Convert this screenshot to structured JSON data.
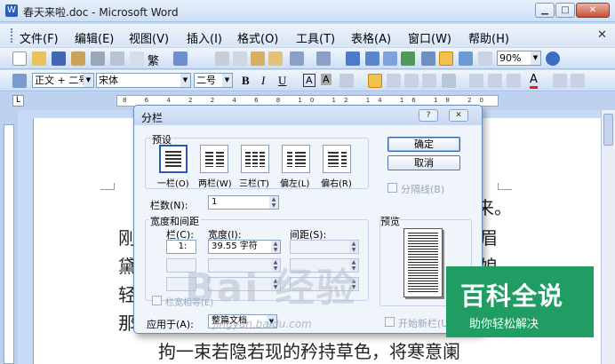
{
  "window": {
    "title": "春天来啦.doc - Microsoft Word",
    "min": "▁",
    "max": "□",
    "close": "✕"
  },
  "menu": [
    "文件(F)",
    "编辑(E)",
    "视图(V)",
    "插入(I)",
    "格式(O)",
    "工具(T)",
    "表格(A)",
    "窗口(W)",
    "帮助(H)"
  ],
  "toolbar": {
    "font_size_trad": "繁",
    "zoom": "90%"
  },
  "format": {
    "style": "正文 + 二号",
    "font": "宋体",
    "size": "二号",
    "bold": "B",
    "italic": "I",
    "underline": "U",
    "char_border": "A",
    "char_shade": "A",
    "font_color": "A"
  },
  "ruler": {
    "ticks": "8 6 4 2 2 4 6 8 10 12 14 16 18 20 22 24 26 28 30 32 34 36 38"
  },
  "document": {
    "l1_left": "刚",
    "l1_right": "眉",
    "l2_left": "黛",
    "l2_right": "娘。",
    "l3_left": "轻",
    "l4_left": "那",
    "l0_right": "来。",
    "l5": "拘一束若隐若现的矜持草色，将寒意阑"
  },
  "dialog": {
    "title": "分栏",
    "help": "?",
    "close": "✕",
    "presets_label": "预设",
    "presets": [
      "一栏(O)",
      "两栏(W)",
      "三栏(T)",
      "偏左(L)",
      "偏右(R)"
    ],
    "ok": "确定",
    "cancel": "取消",
    "separator": "分隔线(B)",
    "num_cols_label": "栏数(N):",
    "num_cols": "1",
    "width_spacing_label": "宽度和间距",
    "col_header": "栏(C):",
    "width_header": "宽度(I):",
    "spacing_header": "间距(S):",
    "row1_col": "1:",
    "row1_width": "39.55 字符",
    "equal_width": "栏宽相等(E)",
    "apply_label": "应用于(A):",
    "apply_value": "整篇文档",
    "preview_label": "预览",
    "new_col": "开始新栏(U)"
  },
  "watermark": {
    "badge_title": "百科全说",
    "badge_sub": "助你轻松解决",
    "baidu_text": "Bai 经验",
    "url": "jingyan.baidu.com"
  }
}
